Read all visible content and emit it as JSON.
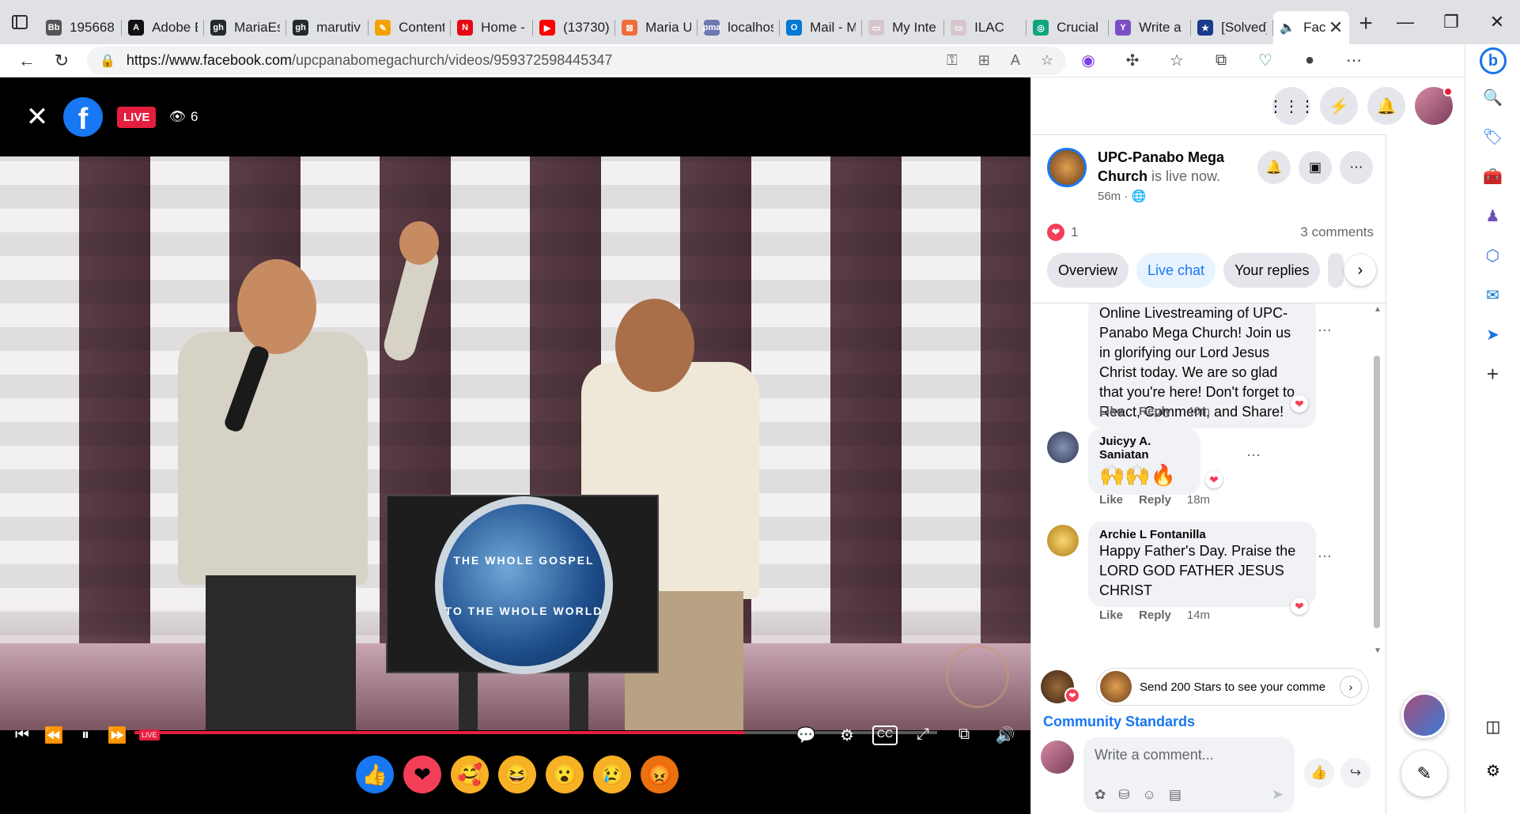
{
  "browser": {
    "tabs": [
      {
        "title": "195668",
        "fav": "Bb",
        "color": "#555"
      },
      {
        "title": "Adobe E",
        "fav": "A",
        "color": "#111"
      },
      {
        "title": "MariaEs",
        "fav": "gh",
        "color": "#24292f"
      },
      {
        "title": "marutiv",
        "fav": "gh",
        "color": "#24292f"
      },
      {
        "title": "Content",
        "fav": "✎",
        "color": "#f4a100"
      },
      {
        "title": "Home -",
        "fav": "N",
        "color": "#e50914"
      },
      {
        "title": "(13730)",
        "fav": "▶",
        "color": "#ff0000"
      },
      {
        "title": "Maria U",
        "fav": "⊠",
        "color": "#ee6e3a"
      },
      {
        "title": "localhos",
        "fav": "pma",
        "color": "#6c78af"
      },
      {
        "title": "Mail - M",
        "fav": "O",
        "color": "#0078d4"
      },
      {
        "title": "My Inte",
        "fav": "▭",
        "color": "#d6c7cc"
      },
      {
        "title": "ILAC",
        "fav": "▭",
        "color": "#d6c7cc"
      },
      {
        "title": "Crucial",
        "fav": "◎",
        "color": "#10a37f"
      },
      {
        "title": "Write a",
        "fav": "Y",
        "color": "#7b4fc4"
      },
      {
        "title": "[Solved]",
        "fav": "★",
        "color": "#1a3b8c"
      }
    ],
    "active_tab": {
      "title": "Fac",
      "fav_icon": "speaker-icon"
    },
    "url_host": "https://www.facebook.com",
    "url_path": "/upcpanabomegachurch/videos/959372598445347"
  },
  "video": {
    "live_label": "LIVE",
    "viewer_count": "6",
    "progress": 0.76,
    "podium_text_top": "THE WHOLE GOSPEL",
    "podium_text_bottom": "TO THE WHOLE WORLD",
    "live_tag": "LIVE"
  },
  "reactions": [
    {
      "name": "like",
      "glyph": "👍",
      "bg": "#1877f2"
    },
    {
      "name": "love",
      "glyph": "❤",
      "bg": "#f33e58"
    },
    {
      "name": "care",
      "glyph": "🥰",
      "bg": "#f7b125"
    },
    {
      "name": "haha",
      "glyph": "😆",
      "bg": "#f7b125"
    },
    {
      "name": "wow",
      "glyph": "😮",
      "bg": "#f7b125"
    },
    {
      "name": "sad",
      "glyph": "😢",
      "bg": "#f7b125"
    },
    {
      "name": "angry",
      "glyph": "😡",
      "bg": "#e9710f"
    }
  ],
  "panel": {
    "page_name": "UPC-Panabo Mega Church",
    "live_status": "is live now.",
    "time_ago": "56m ·",
    "reaction_count": "1",
    "comment_count": "3 comments",
    "tabs": [
      "Overview",
      "Live chat",
      "Your replies"
    ],
    "active_tab": "Live chat"
  },
  "comments": [
    {
      "author": "",
      "text": "Online Livestreaming of UPC-Panabo Mega Church! Join us in glorifying our Lord Jesus Christ today. We are so glad that you're here! Don't forget to React, Comment, and Share!",
      "like": "Like",
      "reply": "Reply",
      "time": "46m"
    },
    {
      "author": "Juicyy A. Saniatan",
      "text": "🙌🙌🔥",
      "like": "Like",
      "reply": "Reply",
      "time": "18m"
    },
    {
      "author": "Archie L Fontanilla",
      "text": "Happy Father's Day. Praise the LORD GOD FATHER JESUS CHRIST",
      "like": "Like",
      "reply": "Reply",
      "time": "14m"
    }
  ],
  "stars_prompt": "Send 200 Stars to see your comme",
  "community_standards": "Community Standards",
  "composer_placeholder": "Write a comment..."
}
